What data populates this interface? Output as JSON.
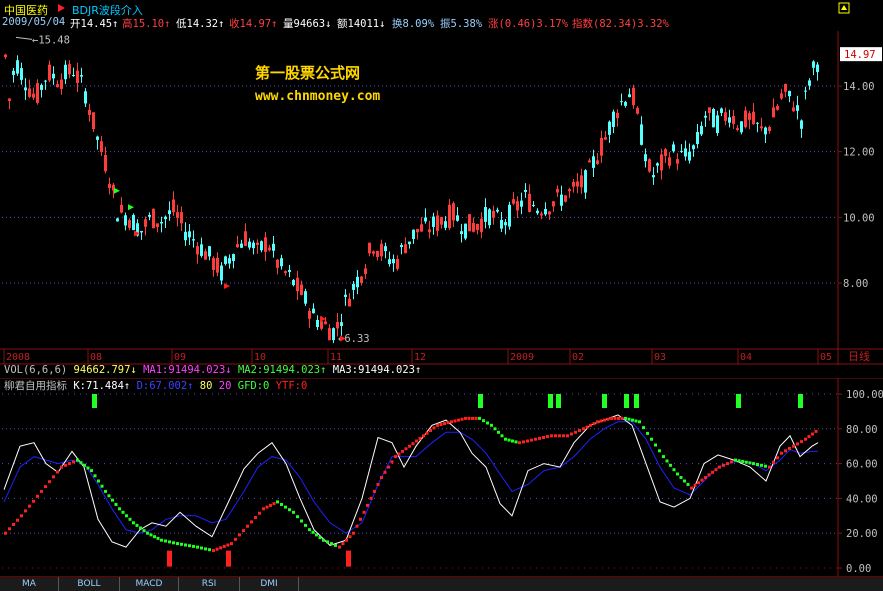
{
  "header": {
    "stock_name": "中国医药",
    "indicator_name": "BDJR波段介入"
  },
  "info": {
    "date": "2009/05/04",
    "open": "开14.45↑",
    "high": "高15.10↑",
    "low": "低14.32↑",
    "close": "收14.97↑",
    "volume": "量94663↓",
    "amount": "额14011↓",
    "turnover": "换8.09%",
    "amplitude": "振5.38%",
    "change": "涨(0.46)3.17%",
    "index": "指数(82.34)3.32%"
  },
  "watermark": {
    "line1": "第一股票公式网",
    "line2": "www.chnmoney.com"
  },
  "price_axis": {
    "labels": [
      "14.00",
      "12.00",
      "10.00",
      "8.00"
    ],
    "current_price": "14.97",
    "max_marker": "15.48",
    "min_marker": "6.33"
  },
  "date_axis": {
    "labels": [
      "2008",
      "08",
      "09",
      "10",
      "11",
      "12",
      "2009",
      "02",
      "03",
      "04",
      "05"
    ],
    "period": "日线"
  },
  "volume_row": {
    "label": "VOL(6,6,6)",
    "vol": "94662.797↓",
    "ma1": "MA1:91494.023↓",
    "ma2": "MA2:91494.023↑",
    "ma3": "MA3:91494.023↑"
  },
  "indicator_row": {
    "name": "柳君自用指标",
    "k": "K:71.484↑",
    "d": "D:67.002↑",
    "level1": "80",
    "level2": "20",
    "gfd": "GFD:0",
    "ytf": "YTF:0"
  },
  "indicator_axis": {
    "labels": [
      "100.00",
      "80.00",
      "60.00",
      "40.00",
      "20.00",
      "0.00"
    ]
  },
  "tabs": [
    "MA",
    "BOLL",
    "MACD",
    "RSI",
    "DMI"
  ],
  "colors": {
    "up": "#ff3c3c",
    "down": "#54ffff",
    "grid": "#8a1010",
    "k_line": "#ffffff",
    "d_line": "#2020ff",
    "signal_up": "#ff2020",
    "signal_down": "#22ff22"
  }
}
